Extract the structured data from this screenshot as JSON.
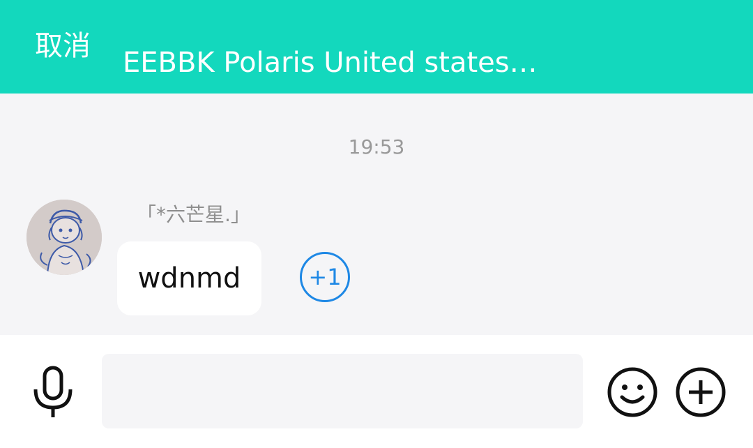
{
  "header": {
    "cancel_label": "取消",
    "title": "EEBBK Polaris United states…",
    "background_color": "#13d8bd"
  },
  "messages": [
    {
      "time": "19:53",
      "sender": "「*六芒星.」",
      "text": "wdnmd",
      "plus_one_label": "+1"
    }
  ],
  "input_bar": {
    "placeholder": "",
    "value": "",
    "icons": [
      "microphone-icon",
      "emoji-icon",
      "plus-icon"
    ]
  }
}
